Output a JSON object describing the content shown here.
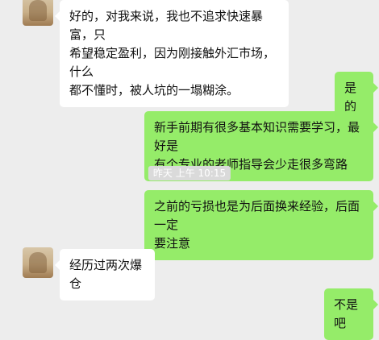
{
  "messages": [
    {
      "side": "left",
      "lines": [
        "好的，对我来说，我也不追求快速暴富，只",
        "希望稳定盈利，因为刚接触外汇市场，什么",
        "都不懂时，被人坑的一塌糊涂。"
      ]
    },
    {
      "side": "right",
      "lines": [
        "是的"
      ]
    },
    {
      "side": "right",
      "lines": [
        "新手前期有很多基本知识需要学习，最好是",
        "有个专业的老师指导会少走很多弯路"
      ]
    },
    {
      "side": "right",
      "lines": [
        "之前的亏损也是为后面换来经验，后面一定",
        "要注意"
      ]
    },
    {
      "side": "left",
      "lines": [
        "经历过两次爆仓"
      ]
    },
    {
      "side": "right",
      "lines": [
        "不是吧"
      ]
    }
  ],
  "timestamp": "昨天 上午 10:15",
  "colors": {
    "background": "#ededed",
    "bubble_left": "#ffffff",
    "bubble_right": "#95ec69"
  }
}
